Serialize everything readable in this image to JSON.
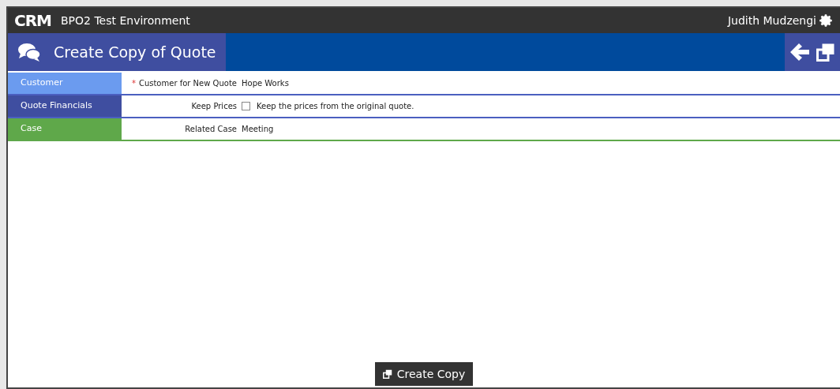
{
  "app": {
    "logo": "CRM",
    "environment": "BPO2 Test Environment",
    "user": "Judith Mudzengi"
  },
  "header": {
    "title": "Create Copy of Quote"
  },
  "sections": [
    {
      "label": "Customer",
      "color": "#6b9bef",
      "field": {
        "kind": "text",
        "label": "Customer for New Quote",
        "required_mark": "*",
        "value": "Hope Works"
      }
    },
    {
      "label": "Quote Financials",
      "color": "#3f4ea0",
      "field": {
        "kind": "checkbox",
        "label": "Keep Prices",
        "checked": false,
        "value": "Keep the prices from the original quote."
      }
    },
    {
      "label": "Case",
      "color": "#5fa84a",
      "field": {
        "kind": "text",
        "label": "Related Case",
        "value": "Meeting"
      }
    }
  ],
  "footer": {
    "button": "Create Copy"
  }
}
